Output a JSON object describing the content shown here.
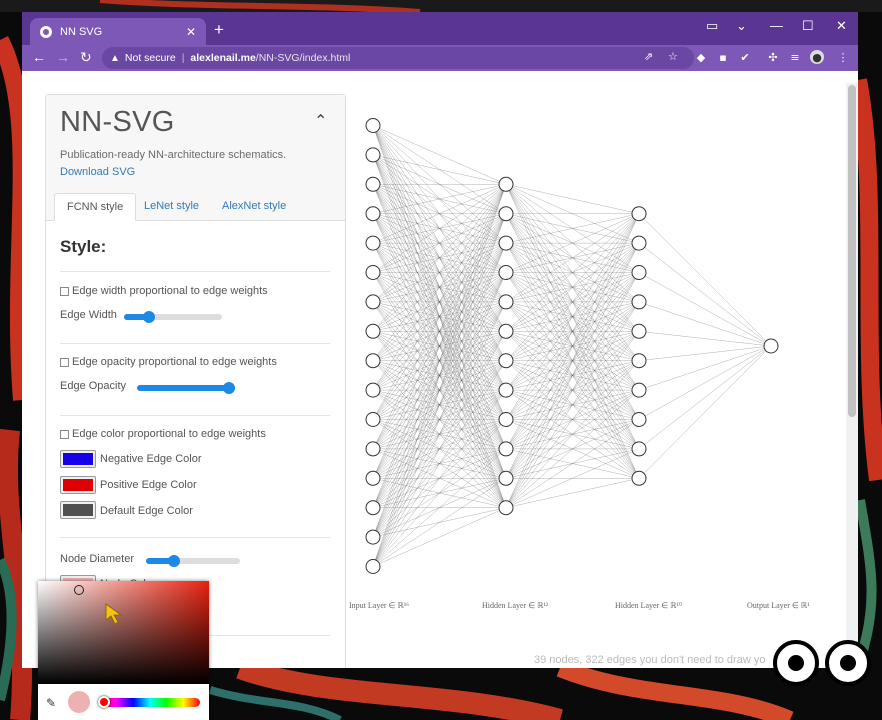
{
  "browser": {
    "tab_title": "NN SVG",
    "tab_close": "✕",
    "new_tab": "+",
    "security_label": "Not secure",
    "url_host": "alexlenail.me",
    "url_path": "/NN-SVG/index.html",
    "theme_color": "#5a3591"
  },
  "app": {
    "title": "NN-SVG",
    "subtitle": "Publication-ready NN-architecture schematics.",
    "download_label": "Download SVG",
    "tabs": [
      {
        "label": "FCNN style",
        "active": true
      },
      {
        "label": "LeNet style",
        "active": false
      },
      {
        "label": "AlexNet style",
        "active": false
      }
    ],
    "style_heading": "Style:",
    "edge_width_checkbox": "Edge width proportional to edge weights",
    "edge_width_label": "Edge Width",
    "edge_width_level": 0.25,
    "edge_opacity_checkbox": "Edge opacity proportional to edge weights",
    "edge_opacity_label": "Edge Opacity",
    "edge_opacity_level": 0.96,
    "edge_color_checkbox": "Edge color proportional to edge weights",
    "negative_color_label": "Negative Edge Color",
    "negative_color": "#1500e8",
    "positive_color_label": "Positive Edge Color",
    "positive_color": "#e00000",
    "default_color_label": "Default Edge Color",
    "default_color": "#505050",
    "node_diameter_label": "Node Diameter",
    "node_diameter_level": 0.3,
    "node_color_label": "Node Color",
    "node_color": "#eeb1b1",
    "accent_color": "#1e88e5",
    "link_color": "#337ab7"
  },
  "network": {
    "layer_sizes": [
      16,
      12,
      10,
      1
    ],
    "layer_labels": [
      "Input Layer ∈ ℝ¹⁶",
      "Hidden Layer ∈ ℝ¹²",
      "Hidden Layer ∈ ℝ¹⁰",
      "Output Layer ∈ ℝ¹"
    ],
    "footer_text": "39 nodes, 322 edges you don't need to draw yo"
  }
}
